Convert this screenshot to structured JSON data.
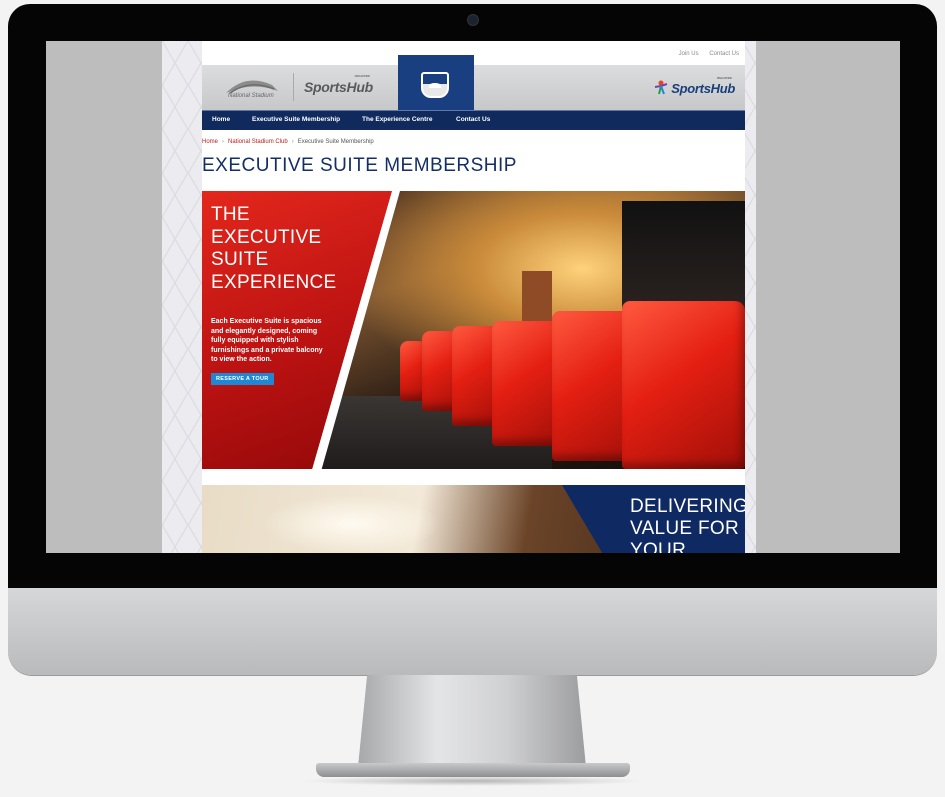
{
  "top_links": [
    "Join Us",
    "Contact Us"
  ],
  "header": {
    "stadium_logo_text": "National Stadium",
    "sportshub_left": {
      "small": "SINGAPORE",
      "name": "SportsHub"
    },
    "sportshub_right": {
      "small": "SINGAPORE",
      "name": "SportsHub"
    }
  },
  "nav": [
    "Home",
    "Executive Suite Membership",
    "The Experience Centre",
    "Contact Us"
  ],
  "breadcrumb": {
    "items": [
      "Home",
      "National Stadium Club",
      "Executive Suite Membership"
    ],
    "separator": "›"
  },
  "page_title": "EXECUTIVE SUITE MEMBERSHIP",
  "hero": {
    "heading": "THE\nEXECUTIVE\nSUITE\nEXPERIENCE",
    "body": "Each Executive Suite is spacious and elegantly designed, coming fully equipped with stylish furnishings and a private balcony to view the action.",
    "button_label": "RESERVE A TOUR"
  },
  "banner2": {
    "heading": "DELIVERING\nVALUE FOR\nYOUR"
  },
  "colors": {
    "navy": "#102a5e",
    "accent_red": "#d11f15",
    "button_blue": "#1e88d4"
  }
}
